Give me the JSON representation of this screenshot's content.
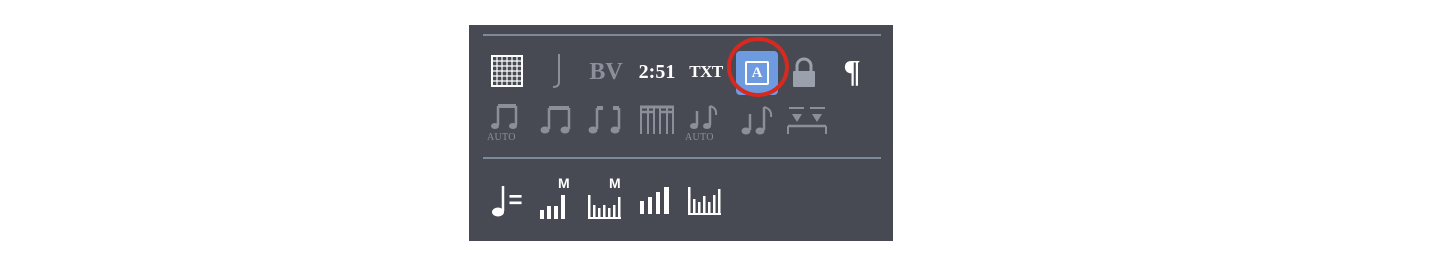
{
  "toolbar": {
    "row1": {
      "grid_icon": "grid-icon",
      "note_icon": "eighth-note-icon",
      "bv_label": "BV",
      "time_label": "2:51",
      "txt_label": "TXT",
      "a_label": "A",
      "lock_icon": "lock-icon",
      "pilcrow_label": "¶"
    },
    "row2": {
      "auto_label_1": "AUTO",
      "auto_label_2": "AUTO"
    },
    "row3": {
      "tempo_label": "=",
      "m_label_1": "M",
      "m_label_2": "M"
    }
  },
  "colors": {
    "panel": "#474a52",
    "divider": "#7f8a99",
    "active": "#6e9be0",
    "highlight": "#d7291f",
    "dim": "#8a8f99"
  }
}
